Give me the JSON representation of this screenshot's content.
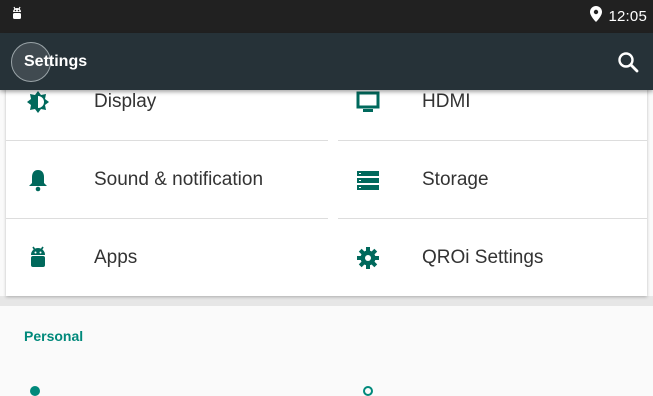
{
  "status_bar": {
    "time": "12:05",
    "icons": [
      "android-notification-icon",
      "location-pin-icon"
    ]
  },
  "app_bar": {
    "title": "Settings",
    "icons": [
      "search-icon"
    ]
  },
  "settings_grid": [
    {
      "label": "Display",
      "icon": "brightness-icon"
    },
    {
      "label": "HDMI",
      "icon": "monitor-icon"
    },
    {
      "label": "Sound & notification",
      "icon": "bell-icon"
    },
    {
      "label": "Storage",
      "icon": "storage-icon"
    },
    {
      "label": "Apps",
      "icon": "android-icon"
    },
    {
      "label": "QROi Settings",
      "icon": "gear-icon"
    }
  ],
  "sections": [
    {
      "header": "Personal"
    }
  ],
  "colors": {
    "status_bar": "#212121",
    "app_bar": "#263238",
    "accent": "#00897b",
    "icon": "#00695c",
    "text": "#333333"
  }
}
